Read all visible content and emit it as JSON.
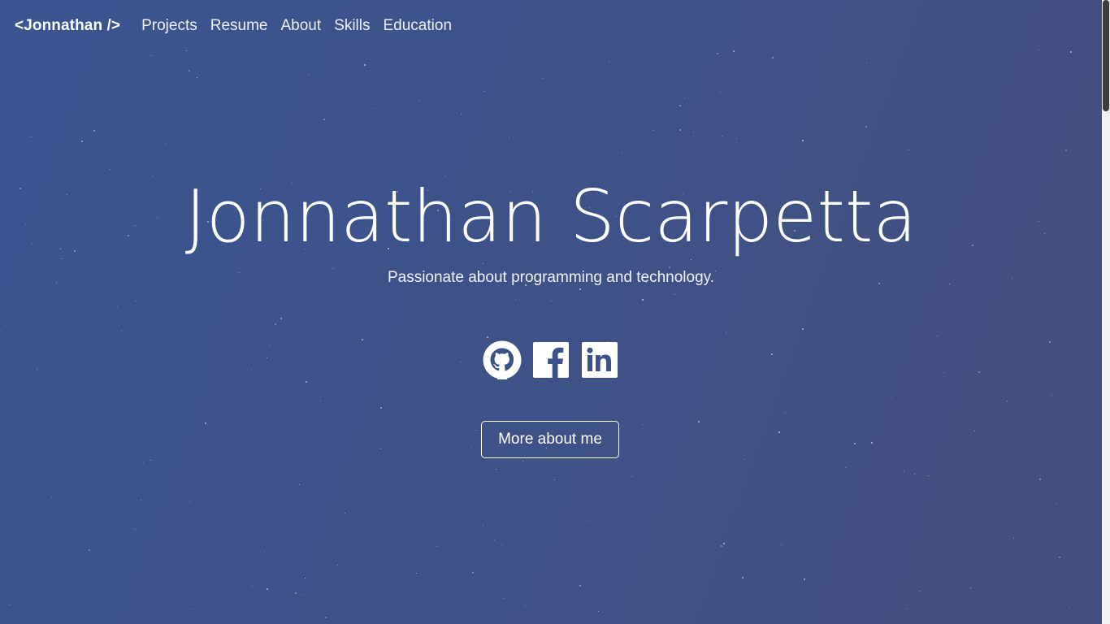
{
  "navbar": {
    "brand": "<Jonnathan />",
    "links": [
      "Projects",
      "Resume",
      "About",
      "Skills",
      "Education"
    ]
  },
  "hero": {
    "title": "Jonnathan Scarpetta",
    "subtitle": "Passionate about programming and technology.",
    "cta_label": "More about me"
  },
  "socials": {
    "icons": [
      "github-icon",
      "facebook-icon",
      "linkedin-icon"
    ]
  },
  "colors": {
    "background_start": "#3a5590",
    "background_end": "#434f7c",
    "text": "#ffffff"
  }
}
